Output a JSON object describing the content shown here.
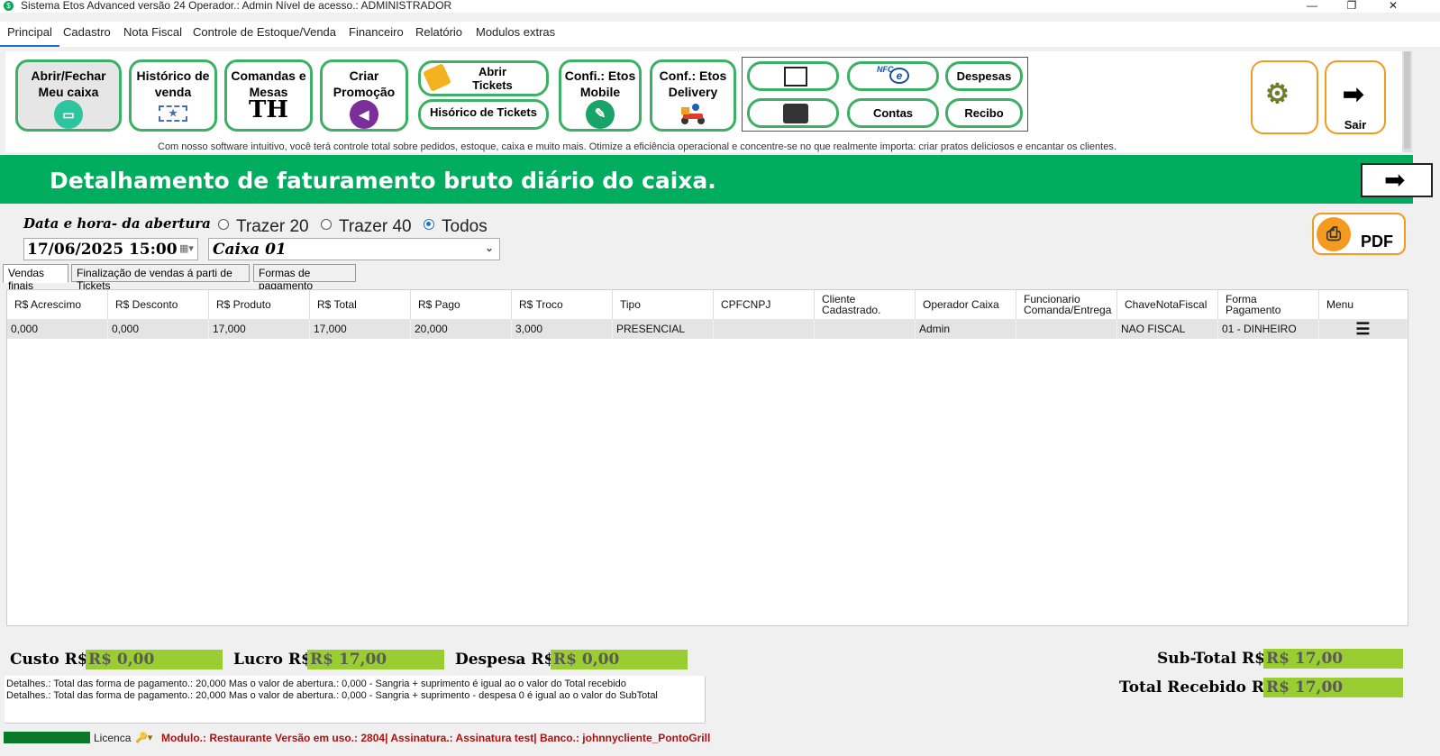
{
  "window": {
    "title": "Sistema Etos  Advanced versão 24  Operador.: Admin Nível de acesso.: ADMINISTRADOR",
    "minimize": "—",
    "maximize": "❐",
    "close": "✕"
  },
  "menu": {
    "items": [
      "Principal",
      "Cadastro",
      "Nota Fiscal",
      "Controle de Estoque/Venda",
      "Financeiro",
      "Relatório",
      "Modulos extras"
    ]
  },
  "toolbar": {
    "abrir_fechar": "Abrir/Fechar Meu caixa",
    "historico": "Histórico de venda",
    "comandas": "Comandas e Mesas",
    "criar_promocao": "Criar Promoção",
    "abrir_tickets": "Abrir Tickets",
    "historico_tickets": "Hisórico de Tickets",
    "conf_mobile": "Confi.: Etos Mobile",
    "conf_delivery": "Conf.: Etos Delivery",
    "nfce_label": "NFC",
    "despesas": "Despesas",
    "contas": "Contas",
    "recibo": "Recibo",
    "sair": "Sair"
  },
  "tagline": "Com nosso software intuitivo, você terá controle total sobre pedidos, estoque, caixa e muito mais. Otimize a eficiência operacional e concentre-se no que realmente importa: criar pratos deliciosos e encantar os clientes.",
  "header": {
    "title": "Detalhamento de faturamento bruto diário do caixa."
  },
  "filters": {
    "date_label": "Data e hora- da abertura",
    "date_value": "17/06/2025 15:00",
    "caixa_value": "Caixa 01",
    "radio_20": "Trazer 20",
    "radio_40": "Trazer 40",
    "radio_todos": "Todos",
    "selected": "Todos",
    "pdf": "PDF"
  },
  "tabs": [
    "Vendas finais",
    "Finalização de vendas á parti de Tickets",
    "Formas de pagamento"
  ],
  "table": {
    "headers": [
      "R$ Acrescimo",
      "R$ Desconto",
      "R$ Produto",
      "R$ Total",
      "R$ Pago",
      "R$ Troco",
      "Tipo",
      "CPFCNPJ",
      "Cliente Cadastrado.",
      "Operador Caixa",
      "Funcionario Comanda/Entrega",
      "ChaveNotaFiscal",
      "Forma Pagamento",
      "Menu"
    ],
    "rows": [
      [
        "0,000",
        "0,000",
        "17,000",
        "17,000",
        "20,000",
        "3,000",
        "PRESENCIAL",
        "",
        "",
        "Admin",
        "",
        "NAO FISCAL",
        "01 - DINHEIRO",
        ""
      ]
    ]
  },
  "footer": {
    "custo_label": "Custo R$",
    "custo_value": "R$ 0,00",
    "lucro_label": "Lucro R$",
    "lucro_value": "R$ 17,00",
    "despesa_label": "Despesa R$",
    "despesa_value": "R$ 0,00",
    "subtotal_label": "Sub-Total R$",
    "subtotal_value": "R$ 17,00",
    "total_label": "Total Recebido R$",
    "total_value": "R$ 17,00",
    "detail_1": "Detalhes.: Total das forma de pagamento.: 20,000 Mas o valor de abertura.: 0,000 - Sangria + suprimento é igual ao o valor do Total recebido",
    "detail_2": "Detalhes.: Total das forma de pagamento.: 20,000 Mas o valor de abertura.: 0,000 - Sangria + suprimento - despesa 0 é igual ao o valor do SubTotal"
  },
  "status": {
    "licenca": "Licenca",
    "modulo": "Modulo.: Restaurante Versão em uso.: 2804| Assinatura.: Assinatura test| Banco.: johnnycliente_PontoGrill"
  },
  "colors": {
    "green": "#00ad5f",
    "button_border": "#3cb064",
    "orange": "#f39a1f",
    "value_bg": "#9acd32"
  }
}
